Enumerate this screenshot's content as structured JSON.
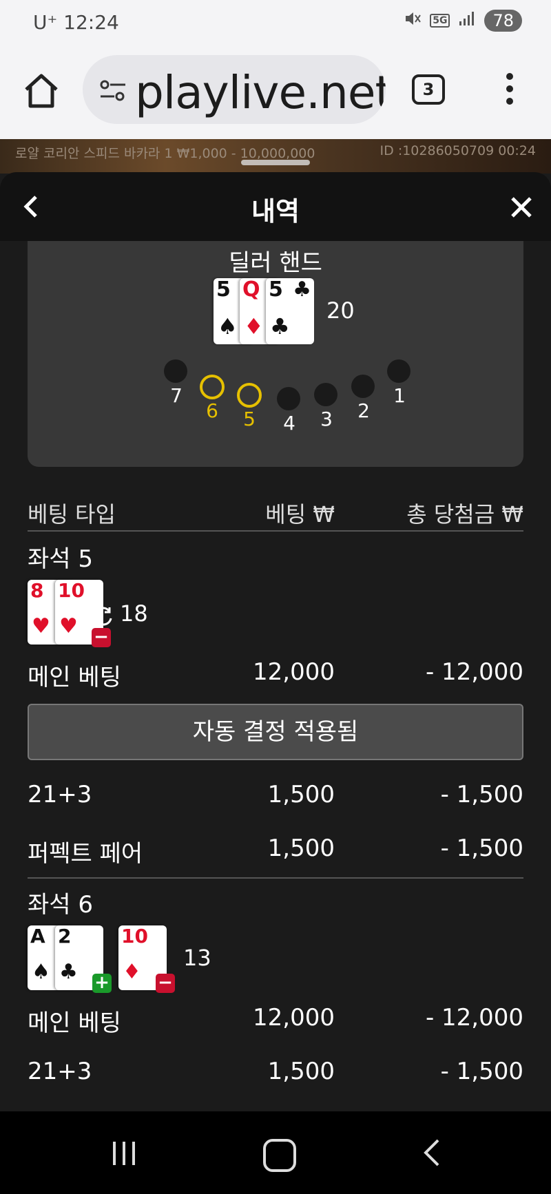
{
  "status": {
    "carrier": "U⁺ 12:24",
    "battery": "78"
  },
  "browser": {
    "url": "playlive.net",
    "tab_count": "3"
  },
  "game_banner": {
    "left": "로얄 코리안 스피드 바카라 1 ₩1,000 - 10,000,000",
    "right": "ID :10286050709 00:24"
  },
  "panel": {
    "title": "내역"
  },
  "dealer": {
    "title": "딜러 핸드",
    "total": "20",
    "cards": [
      {
        "rank": "5",
        "suit": "♠",
        "color": "blk"
      },
      {
        "rank": "Q",
        "suit": "♦",
        "color": "red"
      },
      {
        "rank": "5",
        "suit": "♣",
        "color": "blk"
      }
    ],
    "seats": [
      "7",
      "6",
      "5",
      "4",
      "3",
      "2",
      "1"
    ],
    "active_seats": [
      "6",
      "5"
    ]
  },
  "table_header": {
    "type": "베팅 타입",
    "bet": "베팅 ₩",
    "win": "총 당첨금 ₩"
  },
  "seat5": {
    "label": "좌석 5",
    "total": "18",
    "cards": [
      {
        "rank": "8",
        "suit": "♥",
        "color": "red"
      },
      {
        "rank": "10",
        "suit": "♥",
        "color": "red"
      }
    ],
    "main": {
      "type": "메인 베팅",
      "bet": "12,000",
      "win": "- 12,000"
    },
    "auto_decision": "자동 결정 적용됨",
    "side1": {
      "type": "21+3",
      "bet": "1,500",
      "win": "- 1,500"
    },
    "side2": {
      "type": "퍼펙트 페어",
      "bet": "1,500",
      "win": "- 1,500"
    }
  },
  "seat6": {
    "label": "좌석 6",
    "total": "13",
    "hand1": [
      {
        "rank": "A",
        "suit": "♠",
        "color": "blk"
      },
      {
        "rank": "2",
        "suit": "♣",
        "color": "blk"
      }
    ],
    "hand2": [
      {
        "rank": "10",
        "suit": "♦",
        "color": "red"
      }
    ],
    "main": {
      "type": "메인 베팅",
      "bet": "12,000",
      "win": "- 12,000"
    },
    "side1": {
      "type": "21+3",
      "bet": "1,500",
      "win": "- 1,500"
    }
  },
  "colors": {
    "accent_yellow": "#e6c000",
    "minus_red": "#c8102e",
    "plus_green": "#1a9a2a"
  }
}
